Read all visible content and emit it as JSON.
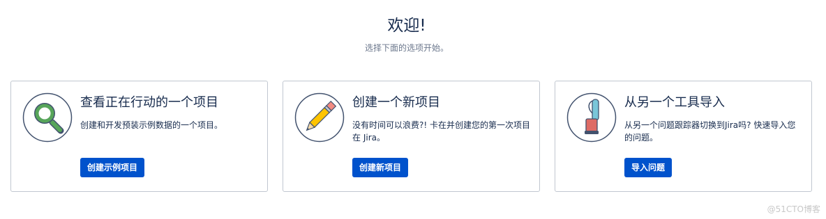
{
  "header": {
    "title": "欢迎!",
    "subtitle": "选择下面的选项开始。"
  },
  "cards": [
    {
      "title": "查看正在行动的一个项目",
      "description": "创建和开发预装示例数据的一个项目。",
      "button_label": "创建示例项目",
      "icon": "magnifier-icon"
    },
    {
      "title": "创建一个新项目",
      "description": "没有时间可以浪费?! 卡在并创建您的第一次项目在 Jira。",
      "button_label": "创建新项目",
      "icon": "pencil-icon"
    },
    {
      "title": "从另一个工具导入",
      "description": "从另一个问题跟踪器切换到Jira吗? 快速导入您的问题。",
      "button_label": "导入问题",
      "icon": "vacuum-cleaner-icon"
    }
  ],
  "watermark": "@51CTO博客",
  "colors": {
    "primary_button": "#0052cc",
    "text": "#172b4d",
    "subtle_text": "#6b778c",
    "border": "#c1c7d0"
  }
}
